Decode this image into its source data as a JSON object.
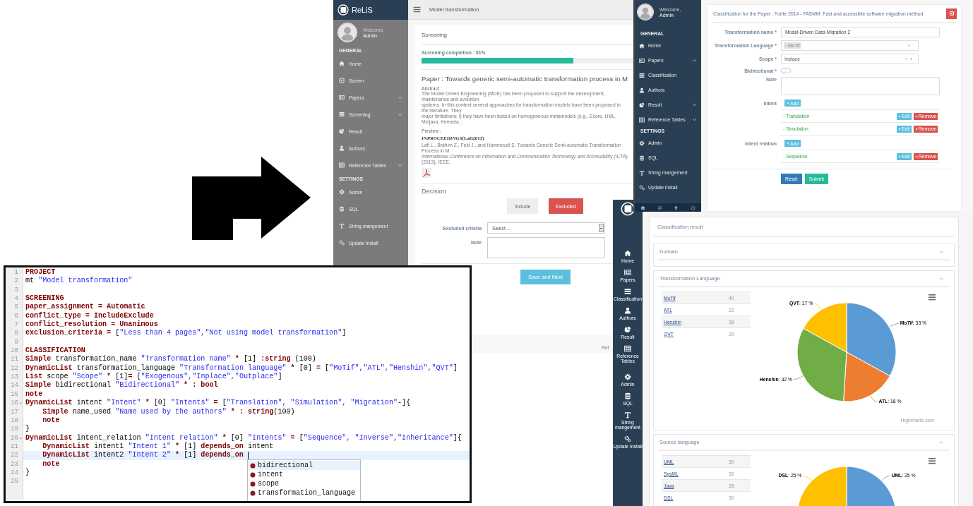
{
  "screening_window": {
    "brand": "ReLiS",
    "user": {
      "greeting": "Welcome,",
      "name": "Admin"
    },
    "sidebar": [
      {
        "heading": "GENERAL",
        "items": [
          {
            "label": "Home",
            "submenu": false
          },
          {
            "label": "Screen",
            "submenu": false
          },
          {
            "label": "Papers",
            "submenu": true
          },
          {
            "label": "Screening",
            "submenu": true
          },
          {
            "label": "Result",
            "submenu": false
          },
          {
            "label": "Authors",
            "submenu": false
          },
          {
            "label": "Reference Tables",
            "submenu": true
          }
        ]
      },
      {
        "heading": "SETTINGS",
        "items": [
          {
            "label": "Admin",
            "submenu": false
          },
          {
            "label": "SQL",
            "submenu": false
          },
          {
            "label": "String mangement",
            "submenu": false
          },
          {
            "label": "Update Install",
            "submenu": false
          }
        ]
      }
    ],
    "project_title": "Model transformation",
    "heading": "Screening",
    "progress": {
      "label": "Screening completion : 61%",
      "level": 0.61
    },
    "paper_title": "Paper : Towards generic semi-automatic transformation process in M",
    "abstract_label": "Abstract :",
    "abstract_lines": [
      "The Model Driven Engineering (MDE) has been proposed to support the development, maintenance and evolution",
      "systems. In this context several approaches for transformation models have been proposed in the literature. They",
      "major limitations: i) they have been tested on homogeneous metamodels (e.g., Ecore, UML, Minjava, Kermeta..."
    ],
    "preview_label": "Preview :",
    "entry_key": "*INPROCEEDINGS*(Lafi2013)",
    "citation_lines": [
      "Lafi L., Brahim Z., Feki J., and Hammoudi S. Towards Generic Semi-automatic Transformation Process in M",
      "*International Conference on Information and Communication Technology and Accessibility (ICTA)* (2013), IEEE,"
    ],
    "decision_heading": "Decision",
    "decisions": [
      {
        "label": "Include",
        "selected": false
      },
      {
        "label": "Excluded",
        "selected": true
      }
    ],
    "criteria": {
      "label": "Excluded criteria",
      "value": "Select ..."
    },
    "note": {
      "label": "Note"
    },
    "submit": "Save and Next",
    "footer": "Rel"
  },
  "classification_window": {
    "user": {
      "greeting": "Welcome,",
      "name": "Admin"
    },
    "sidebar": [
      {
        "heading": "GENERAL",
        "items": [
          {
            "label": "Home",
            "submenu": false
          },
          {
            "label": "Papers",
            "submenu": true
          },
          {
            "label": "Classification",
            "submenu": false
          },
          {
            "label": "Authors",
            "submenu": false
          },
          {
            "label": "Result",
            "submenu": true
          },
          {
            "label": "Reference Tables",
            "submenu": true
          }
        ]
      },
      {
        "heading": "SETTINGS",
        "items": [
          {
            "label": "Admin",
            "submenu": false
          },
          {
            "label": "SQL",
            "submenu": false
          },
          {
            "label": "String mangement",
            "submenu": false
          },
          {
            "label": "Update Install",
            "submenu": false
          }
        ]
      }
    ],
    "title": "Classification for the Paper : Forite 2014 - FASMM: Fast and accessible software migration method",
    "fields": [
      {
        "kind": "text",
        "label": "Transformation name *",
        "value": "Model-Driven Data Migration 2"
      },
      {
        "kind": "tags",
        "label": "Transformation Language *",
        "tags": [
          "MoTif"
        ]
      },
      {
        "kind": "select",
        "label": "Scope *",
        "value": "Inplace"
      },
      {
        "kind": "toggle",
        "label": "Bidirectional *",
        "on": false
      },
      {
        "kind": "textarea",
        "label": "Note"
      }
    ],
    "lists": [
      {
        "label": "Intent",
        "add": "Add",
        "items": [
          {
            "text": "- Translation",
            "edit": "Edit",
            "remove": "Remove"
          },
          {
            "text": "- Simulation",
            "edit": "Edit",
            "remove": "Remove"
          }
        ]
      },
      {
        "label": "Intent relation",
        "add": "Add",
        "items": [
          {
            "text": "- Sequence",
            "edit": "Edit",
            "remove": "Remove"
          }
        ]
      }
    ],
    "buttons": [
      {
        "label": "Reset",
        "kind": "reset"
      },
      {
        "label": "Submit",
        "kind": "submit"
      }
    ]
  },
  "result_window": {
    "sidebar": [
      "Home",
      "Papers",
      "Classification",
      "Authors",
      "Result",
      "Reference Tables",
      "Admin",
      "SQL",
      "String mangement",
      "Update Install"
    ],
    "heading": "Classification result",
    "sections": [
      {
        "title": "Domain",
        "expanded": false
      },
      {
        "title": "Transformation Language",
        "expanded": true,
        "rows": [
          {
            "name": "MoTif",
            "count": "40"
          },
          {
            "name": "ATL",
            "count": "22"
          },
          {
            "name": "Henshin",
            "count": "38"
          },
          {
            "name": "QVT",
            "count": "20"
          }
        ],
        "chart_data": {
          "type": "pie",
          "categories": [
            "MoTif",
            "ATL",
            "Henshin",
            "QVT"
          ],
          "values": [
            33,
            18,
            32,
            17
          ],
          "colors": [
            "#5b9bd5",
            "#ed7d31",
            "#70ad47",
            "#ffc000"
          ],
          "value_labels": [
            ": 33 %",
            ": 18 %",
            ": 32 %",
            ": 17 %"
          ]
        },
        "credit": "Highcharts.com"
      },
      {
        "title": "Source language",
        "expanded": true,
        "rows": [
          {
            "name": "UML",
            "count": "30"
          },
          {
            "name": "SysML",
            "count": "32"
          },
          {
            "name": "Java",
            "count": "28"
          },
          {
            "name": "DSL",
            "count": "30"
          }
        ],
        "chart_data": {
          "type": "pie",
          "categories": [
            "UML",
            "DSL"
          ],
          "values": [
            25,
            25
          ],
          "colors": [
            "#5b9bd5",
            "#ffc000"
          ],
          "value_labels": [
            ": 25 %",
            ": 25 %"
          ]
        }
      }
    ]
  },
  "editor": {
    "lines": [
      {
        "number": "1",
        "current": false,
        "foldable": false,
        "tokens": [
          {
            "kind": "keyword",
            "text": "PROJECT"
          }
        ]
      },
      {
        "number": "2",
        "current": false,
        "foldable": false,
        "tokens": [
          {
            "kind": "plain",
            "text": "mt "
          },
          {
            "kind": "string",
            "text": "\"Model transformation\""
          }
        ]
      },
      {
        "number": "3",
        "current": false,
        "foldable": false
      },
      {
        "number": "4",
        "current": false,
        "foldable": false,
        "tokens": [
          {
            "kind": "keyword",
            "text": "SCREENING"
          }
        ]
      },
      {
        "number": "5",
        "current": false,
        "foldable": false,
        "tokens": [
          {
            "kind": "keyword",
            "text": "paper_assignment = Automatic"
          }
        ]
      },
      {
        "number": "6",
        "current": false,
        "foldable": false,
        "tokens": [
          {
            "kind": "keyword",
            "text": "conflict_type = IncludeExclude"
          }
        ]
      },
      {
        "number": "7",
        "current": false,
        "foldable": false,
        "tokens": [
          {
            "kind": "keyword",
            "text": "conflict_resolution = Unanimous"
          }
        ]
      },
      {
        "number": "8",
        "current": false,
        "foldable": false,
        "tokens": [
          {
            "kind": "keyword",
            "text": "exclusion_criteria = "
          },
          {
            "kind": "plain",
            "text": "["
          },
          {
            "kind": "string",
            "text": "\"Less than 4 pages\",\"Not using model transformation\""
          },
          {
            "kind": "plain",
            "text": "]"
          }
        ]
      },
      {
        "number": "9",
        "current": false,
        "foldable": false
      },
      {
        "number": "10",
        "current": false,
        "foldable": false,
        "tokens": [
          {
            "kind": "keyword",
            "text": "CLASSIFICATION"
          }
        ]
      },
      {
        "number": "11",
        "current": false,
        "foldable": false,
        "tokens": [
          {
            "kind": "keyword",
            "text": "Simple"
          },
          {
            "kind": "plain",
            "text": " transformation_name "
          },
          {
            "kind": "string",
            "text": "\"Transformation name\""
          },
          {
            "kind": "keyword",
            "text": " * "
          },
          {
            "kind": "plain",
            "text": "[1] "
          },
          {
            "kind": "keyword",
            "text": ":string"
          },
          {
            "kind": "plain",
            "text": " (100)"
          }
        ]
      },
      {
        "number": "12",
        "current": false,
        "foldable": false,
        "tokens": [
          {
            "kind": "keyword",
            "text": "DynamicList"
          },
          {
            "kind": "plain",
            "text": " transformation_language "
          },
          {
            "kind": "string",
            "text": "\"Transformation language\""
          },
          {
            "kind": "keyword",
            "text": " * "
          },
          {
            "kind": "plain",
            "text": "[0] "
          },
          {
            "kind": "keyword",
            "text": "= "
          },
          {
            "kind": "plain",
            "text": "["
          },
          {
            "kind": "string",
            "text": "\"MoTif\",\"ATL\",\"Henshin\",\"QVT\""
          },
          {
            "kind": "plain",
            "text": "]"
          }
        ]
      },
      {
        "number": "13",
        "current": false,
        "foldable": false,
        "tokens": [
          {
            "kind": "keyword",
            "text": "List"
          },
          {
            "kind": "plain",
            "text": " scope "
          },
          {
            "kind": "string",
            "text": "\"Scope\""
          },
          {
            "kind": "keyword",
            "text": " * "
          },
          {
            "kind": "plain",
            "text": "[1]"
          },
          {
            "kind": "keyword",
            "text": "= "
          },
          {
            "kind": "plain",
            "text": "["
          },
          {
            "kind": "string",
            "text": "\"Exogenous\",\"Inplace\",\"Outplace\""
          },
          {
            "kind": "plain",
            "text": "]"
          }
        ]
      },
      {
        "number": "14",
        "current": false,
        "foldable": false,
        "tokens": [
          {
            "kind": "keyword",
            "text": "Simple"
          },
          {
            "kind": "plain",
            "text": " bidirectional "
          },
          {
            "kind": "string",
            "text": "\"Bidirectional\""
          },
          {
            "kind": "keyword",
            "text": " * : bool"
          }
        ]
      },
      {
        "number": "15",
        "current": false,
        "foldable": false,
        "tokens": [
          {
            "kind": "keyword",
            "text": "note"
          }
        ]
      },
      {
        "number": "16",
        "current": false,
        "foldable": true,
        "tokens": [
          {
            "kind": "keyword",
            "text": "DynamicList"
          },
          {
            "kind": "plain",
            "text": " intent "
          },
          {
            "kind": "string",
            "text": "\"Intent\""
          },
          {
            "kind": "keyword",
            "text": " * "
          },
          {
            "kind": "plain",
            "text": "[0] "
          },
          {
            "kind": "string",
            "text": "\"Intents\""
          },
          {
            "kind": "keyword",
            "text": " = "
          },
          {
            "kind": "plain",
            "text": "["
          },
          {
            "kind": "string",
            "text": "\"Translation\", \"Simulation\", \"Migration\""
          },
          {
            "kind": "plain",
            "text": "-]{"
          }
        ]
      },
      {
        "number": "17",
        "current": false,
        "foldable": false,
        "tokens": [
          {
            "kind": "keyword",
            "text": "    Simple"
          },
          {
            "kind": "plain",
            "text": " name_used "
          },
          {
            "kind": "string",
            "text": "\"Name used by the authors\""
          },
          {
            "kind": "keyword",
            "text": " * : string"
          },
          {
            "kind": "plain",
            "text": "(100)"
          }
        ]
      },
      {
        "number": "18",
        "current": false,
        "foldable": false,
        "tokens": [
          {
            "kind": "keyword",
            "text": "    note"
          }
        ]
      },
      {
        "number": "19",
        "current": false,
        "foldable": false,
        "tokens": [
          {
            "kind": "plain",
            "text": "}"
          }
        ]
      },
      {
        "number": "20",
        "current": false,
        "foldable": true,
        "tokens": [
          {
            "kind": "keyword",
            "text": "DynamicList"
          },
          {
            "kind": "plain",
            "text": " intent_relation "
          },
          {
            "kind": "string",
            "text": "\"Intent relation\""
          },
          {
            "kind": "keyword",
            "text": " * "
          },
          {
            "kind": "plain",
            "text": "[0] "
          },
          {
            "kind": "string",
            "text": "\"Intents\""
          },
          {
            "kind": "keyword",
            "text": " = "
          },
          {
            "kind": "plain",
            "text": "["
          },
          {
            "kind": "string",
            "text": "\"Sequence\", \"Inverse\",\"Inheritance\""
          },
          {
            "kind": "plain",
            "text": "]{"
          }
        ]
      },
      {
        "number": "21",
        "current": false,
        "foldable": false,
        "tokens": [
          {
            "kind": "keyword",
            "text": "    DynamicList"
          },
          {
            "kind": "plain",
            "text": " intent1 "
          },
          {
            "kind": "string",
            "text": "\"Intent 1\""
          },
          {
            "kind": "keyword",
            "text": " * "
          },
          {
            "kind": "plain",
            "text": "[1] "
          },
          {
            "kind": "keyword",
            "text": "depends_on"
          },
          {
            "kind": "plain",
            "text": " intent"
          }
        ]
      },
      {
        "number": "22",
        "current": true,
        "foldable": false,
        "tokens": [
          {
            "kind": "keyword",
            "text": "    DynamicList"
          },
          {
            "kind": "plain",
            "text": " intent2 "
          },
          {
            "kind": "string",
            "text": "\"Intent 2\""
          },
          {
            "kind": "keyword",
            "text": " * "
          },
          {
            "kind": "plain",
            "text": "[1] "
          },
          {
            "kind": "keyword",
            "text": "depends_on"
          }
        ]
      },
      {
        "number": "23",
        "current": false,
        "foldable": false,
        "tokens": [
          {
            "kind": "keyword",
            "text": "    note"
          }
        ]
      },
      {
        "number": "24",
        "current": false,
        "foldable": false,
        "tokens": [
          {
            "kind": "plain",
            "text": "}"
          }
        ]
      },
      {
        "number": "25",
        "current": false,
        "foldable": false
      }
    ],
    "autocomplete": [
      {
        "label": "bidirectional",
        "selected": true
      },
      {
        "label": "intent",
        "selected": false
      },
      {
        "label": "scope",
        "selected": false
      },
      {
        "label": "transformation_language",
        "selected": false
      }
    ]
  }
}
